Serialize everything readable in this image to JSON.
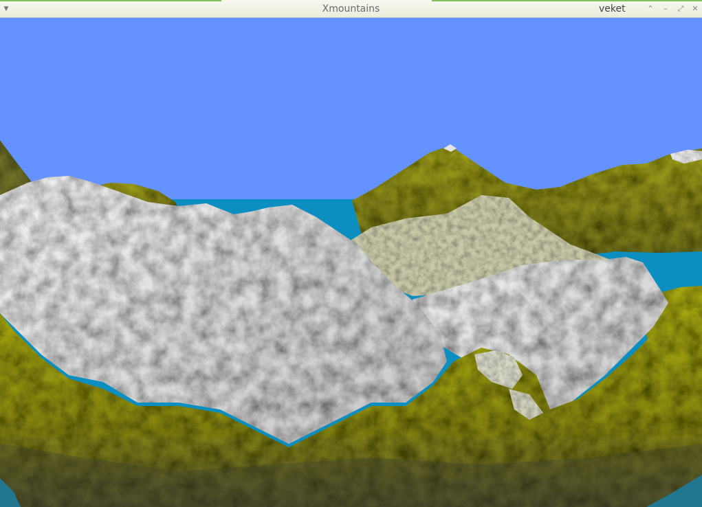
{
  "window": {
    "title": "Xmountains",
    "host": "veket",
    "menu_glyph": "▼",
    "buttons": {
      "shade": "⌃",
      "minimize": "–",
      "maximize": "⤢",
      "close": "✕"
    }
  },
  "colors": {
    "sky": "#6492ff",
    "water": "#0c8fc0",
    "snow": "#e8e8e8",
    "grass": "#9a9a10",
    "dark_grass": "#5e5e22",
    "titlebar": "#eef2e4"
  }
}
